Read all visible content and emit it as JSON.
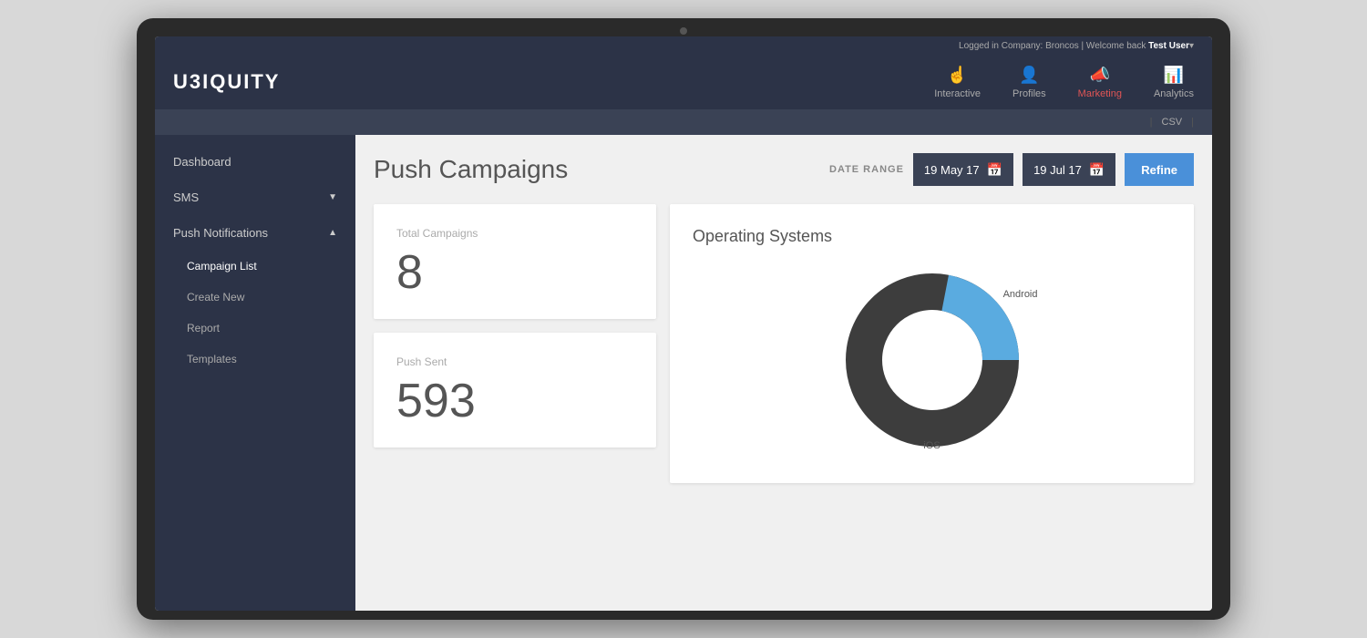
{
  "app": {
    "logo": "U3IQUITY",
    "user_bar": {
      "logged_in_label": "Logged in Company: Broncos | Welcome back",
      "username": "Test User",
      "dropdown_icon": "▾"
    }
  },
  "nav": {
    "items": [
      {
        "id": "interactive",
        "label": "Interactive",
        "icon": "☝",
        "active": false
      },
      {
        "id": "profiles",
        "label": "Profiles",
        "icon": "👤",
        "active": false
      },
      {
        "id": "marketing",
        "label": "Marketing",
        "icon": "📣",
        "active": true
      },
      {
        "id": "analytics",
        "label": "Analytics",
        "icon": "📊",
        "active": false
      }
    ]
  },
  "secondary_bar": {
    "items": [
      "CSV"
    ]
  },
  "sidebar": {
    "items": [
      {
        "id": "dashboard",
        "label": "Dashboard",
        "type": "item",
        "active": false
      },
      {
        "id": "sms",
        "label": "SMS",
        "type": "section",
        "expanded": false
      },
      {
        "id": "push-notifications",
        "label": "Push Notifications",
        "type": "section",
        "expanded": true
      },
      {
        "id": "campaign-list",
        "label": "Campaign List",
        "type": "sub",
        "active": true
      },
      {
        "id": "create-new",
        "label": "Create New",
        "type": "sub",
        "active": false
      },
      {
        "id": "report",
        "label": "Report",
        "type": "sub",
        "active": false
      },
      {
        "id": "templates",
        "label": "Templates",
        "type": "sub",
        "active": false
      }
    ]
  },
  "page": {
    "title": "Push Campaigns",
    "date_range_label": "DATE RANGE",
    "date_from": "19 May 17",
    "date_to": "19 Jul 17",
    "refine_button": "Refine",
    "csv_label": "CSV"
  },
  "stats": [
    {
      "id": "total-campaigns",
      "label": "Total Campaigns",
      "value": "8"
    },
    {
      "id": "push-sent",
      "label": "Push Sent",
      "value": "593"
    }
  ],
  "chart": {
    "title": "Operating Systems",
    "segments": [
      {
        "id": "android",
        "label": "Android",
        "value": 22,
        "color": "#5aabe0"
      },
      {
        "id": "ios",
        "label": "iOS",
        "value": 78,
        "color": "#3d3d3d"
      }
    ]
  }
}
